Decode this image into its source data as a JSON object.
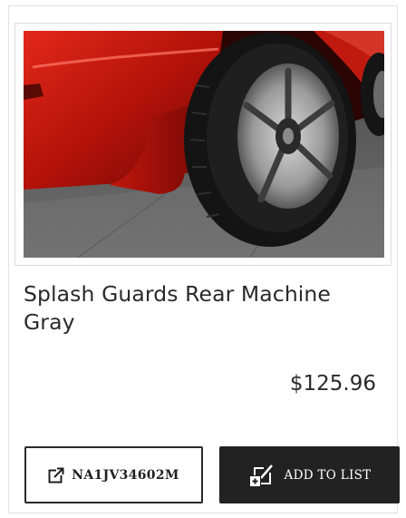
{
  "product": {
    "name": "Splash Guards Rear Machine Gray",
    "price": "$125.96",
    "image_subject": "red car rear wheel with splash guard"
  },
  "actions": {
    "part_number_label": "NA1JV34602M",
    "part_number_icon": "external-link-icon",
    "add_to_list_label": "ADD TO LIST",
    "add_to_list_icon": "add-to-list-icon"
  },
  "colors": {
    "dark_button": "#222222",
    "car_red": "#c2170e"
  }
}
